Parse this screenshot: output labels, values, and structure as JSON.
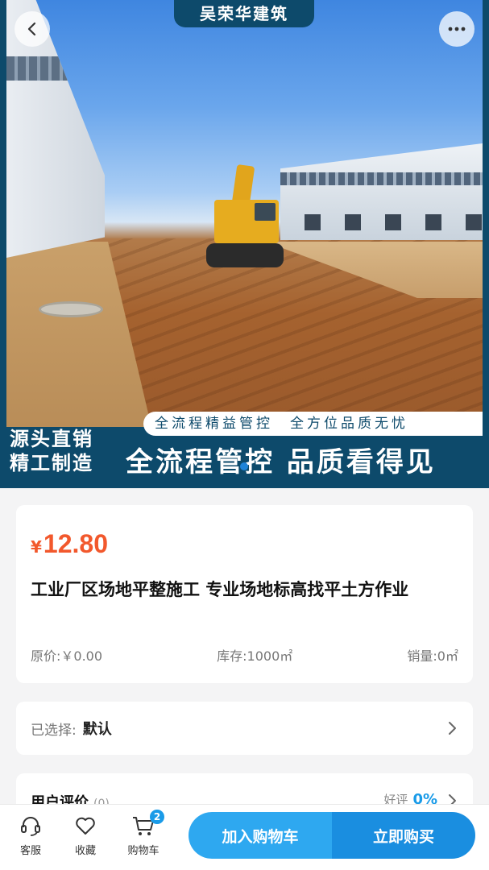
{
  "hero": {
    "brand": "吴荣华建筑",
    "slogan_strip": "全流程精益管控　全方位品质无忧",
    "slogan_left_line1": "源头直销",
    "slogan_left_line2": "精工制造",
    "slogan_big": "全流程管控 品质看得见",
    "back_icon": "chevron-left-icon",
    "more_icon": "more-horizontal-icon"
  },
  "product": {
    "currency": "¥",
    "price": "12.80",
    "title": "工业厂区场地平整施工 专业场地标高找平土方作业",
    "original_price": "原价:￥0.00",
    "stock": "库存:1000㎡",
    "sales": "销量:0㎡"
  },
  "selection": {
    "label": "已选择:",
    "value": "默认"
  },
  "review": {
    "title": "用户评价",
    "count": "(0)",
    "rate_label": "好评",
    "rate_value": "0%"
  },
  "bottom_bar": {
    "service_label": "客服",
    "favorite_label": "收藏",
    "cart_label": "购物车",
    "cart_count": "2",
    "add_to_cart": "加入购物车",
    "buy_now": "立即购买"
  },
  "colors": {
    "brand_navy": "#0d4a6b",
    "price_red": "#f2582c",
    "accent_blue": "#1a9be8"
  }
}
